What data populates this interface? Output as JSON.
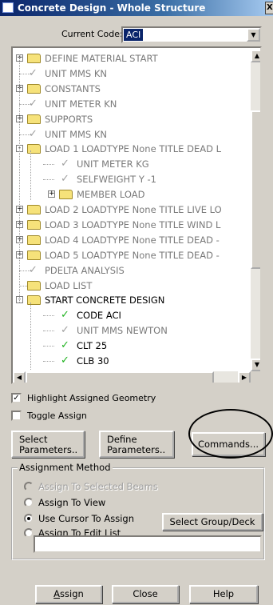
{
  "window": {
    "title": "Concrete Design - Whole Structure",
    "close_glyph": "X"
  },
  "code": {
    "label": "Current Code:",
    "value": "ACI"
  },
  "tree": {
    "rows": [
      {
        "text": "DEFINE MATERIAL START",
        "level": 0,
        "kind": "folder",
        "expander": "+",
        "style": "gray"
      },
      {
        "text": "UNIT MMS KN",
        "level": 0,
        "kind": "check",
        "style": "gray"
      },
      {
        "text": "CONSTANTS",
        "level": 0,
        "kind": "folder",
        "expander": "+",
        "style": "gray"
      },
      {
        "text": "UNIT METER KN",
        "level": 0,
        "kind": "check",
        "style": "gray"
      },
      {
        "text": "SUPPORTS",
        "level": 0,
        "kind": "folder",
        "expander": "+",
        "style": "gray"
      },
      {
        "text": "UNIT MMS KN",
        "level": 0,
        "kind": "check",
        "style": "gray"
      },
      {
        "text": "LOAD 1 LOADTYPE None  TITLE DEAD L",
        "level": 0,
        "kind": "folder",
        "expander": "-",
        "style": "gray"
      },
      {
        "text": "UNIT METER KG",
        "level": 1,
        "kind": "check",
        "style": "gray"
      },
      {
        "text": "SELFWEIGHT Y -1",
        "level": 1,
        "kind": "check",
        "style": "gray"
      },
      {
        "text": "MEMBER LOAD",
        "level": 1,
        "kind": "folder",
        "expander": "+",
        "style": "gray"
      },
      {
        "text": "LOAD 2 LOADTYPE None  TITLE LIVE LO",
        "level": 0,
        "kind": "folder",
        "expander": "+",
        "style": "gray"
      },
      {
        "text": "LOAD 3 LOADTYPE None  TITLE WIND L",
        "level": 0,
        "kind": "folder",
        "expander": "+",
        "style": "gray"
      },
      {
        "text": "LOAD 4 LOADTYPE None  TITLE DEAD -",
        "level": 0,
        "kind": "folder",
        "expander": "+",
        "style": "gray"
      },
      {
        "text": "LOAD 5 LOADTYPE None  TITLE DEAD -",
        "level": 0,
        "kind": "folder",
        "expander": "+",
        "style": "gray"
      },
      {
        "text": "PDELTA ANALYSIS",
        "level": 0,
        "kind": "check",
        "style": "gray"
      },
      {
        "text": "LOAD LIST",
        "level": 0,
        "kind": "folder",
        "style": "gray"
      },
      {
        "text": "START CONCRETE DESIGN",
        "level": 0,
        "kind": "folder",
        "expander": "-",
        "style": "black"
      },
      {
        "text": "CODE ACI",
        "level": 1,
        "kind": "check",
        "style": "black",
        "check": "green"
      },
      {
        "text": "UNIT MMS NEWTON",
        "level": 1,
        "kind": "check",
        "style": "gray"
      },
      {
        "text": "CLT 25",
        "level": 1,
        "kind": "check",
        "style": "black",
        "check": "green"
      },
      {
        "text": "CLB 30",
        "level": 1,
        "kind": "check",
        "style": "black",
        "check": "green"
      }
    ]
  },
  "options": {
    "highlight_label": "Highlight Assigned Geometry",
    "highlight_checked": true,
    "toggle_label": "Toggle Assign",
    "toggle_checked": false
  },
  "buttons": {
    "select_params_line1": "Select",
    "select_params_line2": "Parameters..",
    "define_params_line1": "Define",
    "define_params_line2": "Parameters..",
    "commands": "Commands...",
    "select_group": "Select Group/Deck",
    "assign": "Assign",
    "close": "Close",
    "help": "Help"
  },
  "assignment": {
    "legend": "Assignment Method",
    "options": [
      {
        "label": "Assign To Selected Beams",
        "enabled": false,
        "selected": false
      },
      {
        "label": "Assign To View",
        "enabled": true,
        "selected": false
      },
      {
        "label": "Use Cursor To Assign",
        "enabled": true,
        "selected": true
      },
      {
        "label": "Assign To Edit List",
        "enabled": true,
        "selected": false
      }
    ],
    "edit_list_value": ""
  }
}
